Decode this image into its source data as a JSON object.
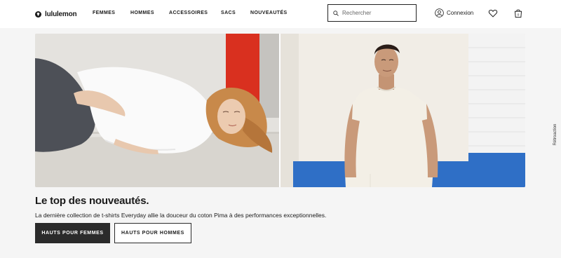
{
  "brand": {
    "name": "lululemon"
  },
  "nav": {
    "items": [
      "FEMMES",
      "HOMMES",
      "ACCESSOIRES",
      "SACS",
      "NOUVEAUTÉS"
    ]
  },
  "search": {
    "placeholder": "Rechercher",
    "value": ""
  },
  "account": {
    "label": "Connexion"
  },
  "icons": {
    "search": "search-icon",
    "account": "user-circle-icon",
    "wishlist": "heart-icon",
    "bag": "shopping-bag-icon"
  },
  "bag": {
    "count": "0"
  },
  "hero": {
    "title": "Le top des nouveautés.",
    "subtitle": "La dernière collection de t-shirts Everyday allie la douceur du coton Pima à des performances exceptionnelles.",
    "primary_button": "HAUTS POUR FEMMES",
    "secondary_button": "HAUTS POUR HOMMES"
  },
  "feedback": {
    "label": "Rétroaction"
  },
  "colors": {
    "accent_dark": "#2b2b2b",
    "background": "#f5f5f5",
    "header": "#ffffff"
  }
}
